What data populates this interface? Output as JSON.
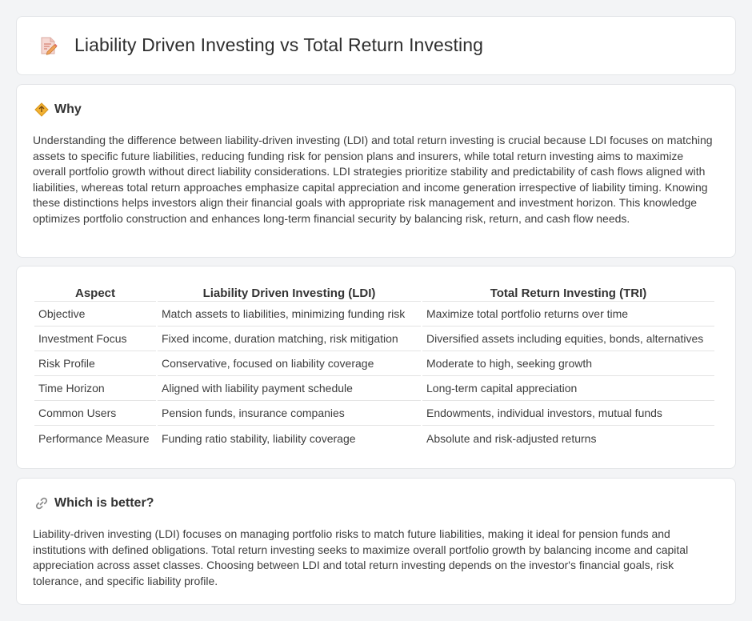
{
  "header": {
    "title": "Liability Driven Investing vs Total Return Investing",
    "icon": "document-pencil-icon"
  },
  "why": {
    "icon": "diamond-warning-icon",
    "title": "Why",
    "text": "Understanding the difference between liability-driven investing (LDI) and total return investing is crucial because LDI focuses on matching assets to specific future liabilities, reducing funding risk for pension plans and insurers, while total return investing aims to maximize overall portfolio growth without direct liability considerations. LDI strategies prioritize stability and predictability of cash flows aligned with liabilities, whereas total return approaches emphasize capital appreciation and income generation irrespective of liability timing. Knowing these distinctions helps investors align their financial goals with appropriate risk management and investment horizon. This knowledge optimizes portfolio construction and enhances long-term financial security by balancing risk, return, and cash flow needs."
  },
  "table": {
    "headers": [
      "Aspect",
      "Liability Driven Investing (LDI)",
      "Total Return Investing (TRI)"
    ],
    "rows": [
      [
        "Objective",
        "Match assets to liabilities, minimizing funding risk",
        "Maximize total portfolio returns over time"
      ],
      [
        "Investment Focus",
        "Fixed income, duration matching, risk mitigation",
        "Diversified assets including equities, bonds, alternatives"
      ],
      [
        "Risk Profile",
        "Conservative, focused on liability coverage",
        "Moderate to high, seeking growth"
      ],
      [
        "Time Horizon",
        "Aligned with liability payment schedule",
        "Long-term capital appreciation"
      ],
      [
        "Common Users",
        "Pension funds, insurance companies",
        "Endowments, individual investors, mutual funds"
      ],
      [
        "Performance Measure",
        "Funding ratio stability, liability coverage",
        "Absolute and risk-adjusted returns"
      ]
    ]
  },
  "better": {
    "icon": "link-icon",
    "title": "Which is better?",
    "text": "Liability-driven investing (LDI) focuses on managing portfolio risks to match future liabilities, making it ideal for pension funds and institutions with defined obligations. Total return investing seeks to maximize overall portfolio growth by balancing income and capital appreciation across asset classes. Choosing between LDI and total return investing depends on the investor's financial goals, risk tolerance, and specific liability profile."
  }
}
